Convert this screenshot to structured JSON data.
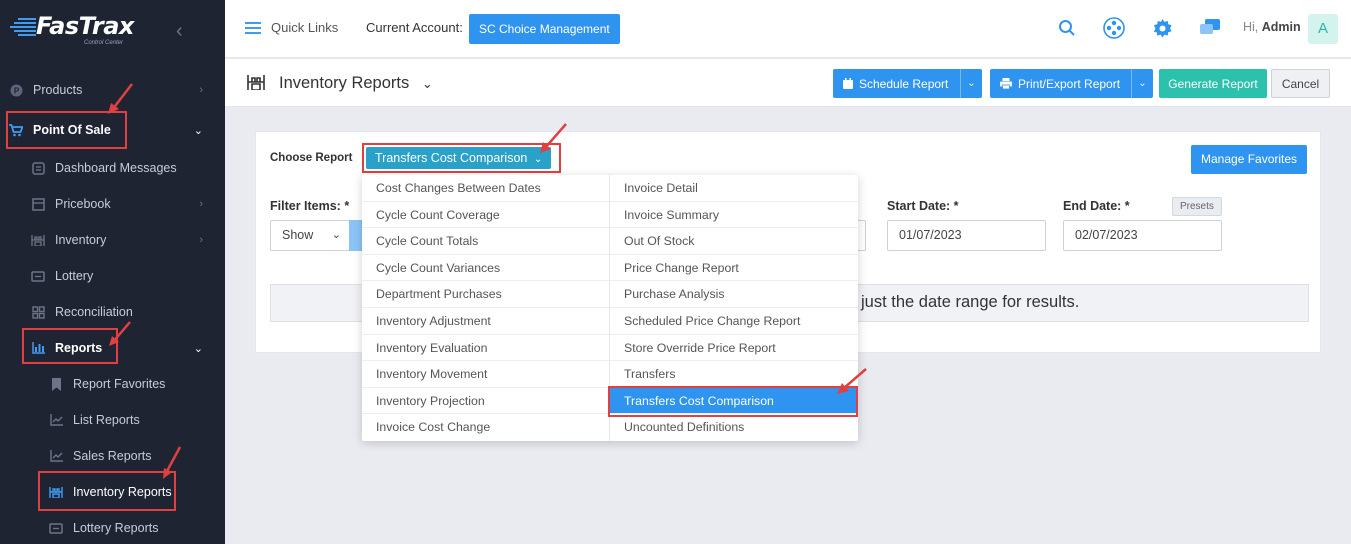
{
  "sidebar": {
    "logo_text": "FasTrax",
    "logo_sub": "Control Center",
    "items": [
      {
        "label": "Products"
      },
      {
        "label": "Point Of Sale"
      },
      {
        "label": "Dashboard Messages"
      },
      {
        "label": "Pricebook"
      },
      {
        "label": "Inventory"
      },
      {
        "label": "Lottery"
      },
      {
        "label": "Reconciliation"
      },
      {
        "label": "Reports"
      },
      {
        "label": "Report Favorites"
      },
      {
        "label": "List Reports"
      },
      {
        "label": "Sales Reports"
      },
      {
        "label": "Inventory Reports"
      },
      {
        "label": "Lottery Reports"
      }
    ]
  },
  "topbar": {
    "quick_links": "Quick Links",
    "account_label": "Current Account:",
    "account_value": "SC Choice Management",
    "greeting_prefix": "Hi,",
    "user_name": "Admin",
    "avatar_letter": "A"
  },
  "header": {
    "title": "Inventory Reports",
    "schedule_btn": "Schedule Report",
    "print_btn": "Print/Export Report",
    "generate_btn": "Generate Report",
    "cancel_btn": "Cancel"
  },
  "form": {
    "choose_report_label": "Choose Report",
    "selected_report": "Transfers Cost Comparison",
    "manage_favorites": "Manage Favorites",
    "filter_items_label": "Filter Items: *",
    "filter_value": "Show",
    "start_date_label": "Start Date: *",
    "start_date": "01/07/2023",
    "end_date_label": "End Date: *",
    "end_date": "02/07/2023",
    "presets": "Presets",
    "info_message": "just the date range for results."
  },
  "dropdown": {
    "left": [
      "Cost Changes Between Dates",
      "Cycle Count Coverage",
      "Cycle Count Totals",
      "Cycle Count Variances",
      "Department Purchases",
      "Inventory Adjustment",
      "Inventory Evaluation",
      "Inventory Movement",
      "Inventory Projection",
      "Invoice Cost Change"
    ],
    "right": [
      "Invoice Detail",
      "Invoice Summary",
      "Out Of Stock",
      "Price Change Report",
      "Purchase Analysis",
      "Scheduled Price Change Report",
      "Store Override Price Report",
      "Transfers",
      "Transfers Cost Comparison",
      "Uncounted Definitions"
    ]
  },
  "colors": {
    "sidebar_bg": "#1f2433",
    "primary": "#2f94f0",
    "teal": "#2cc1ad",
    "highlight": "#e0403f"
  }
}
